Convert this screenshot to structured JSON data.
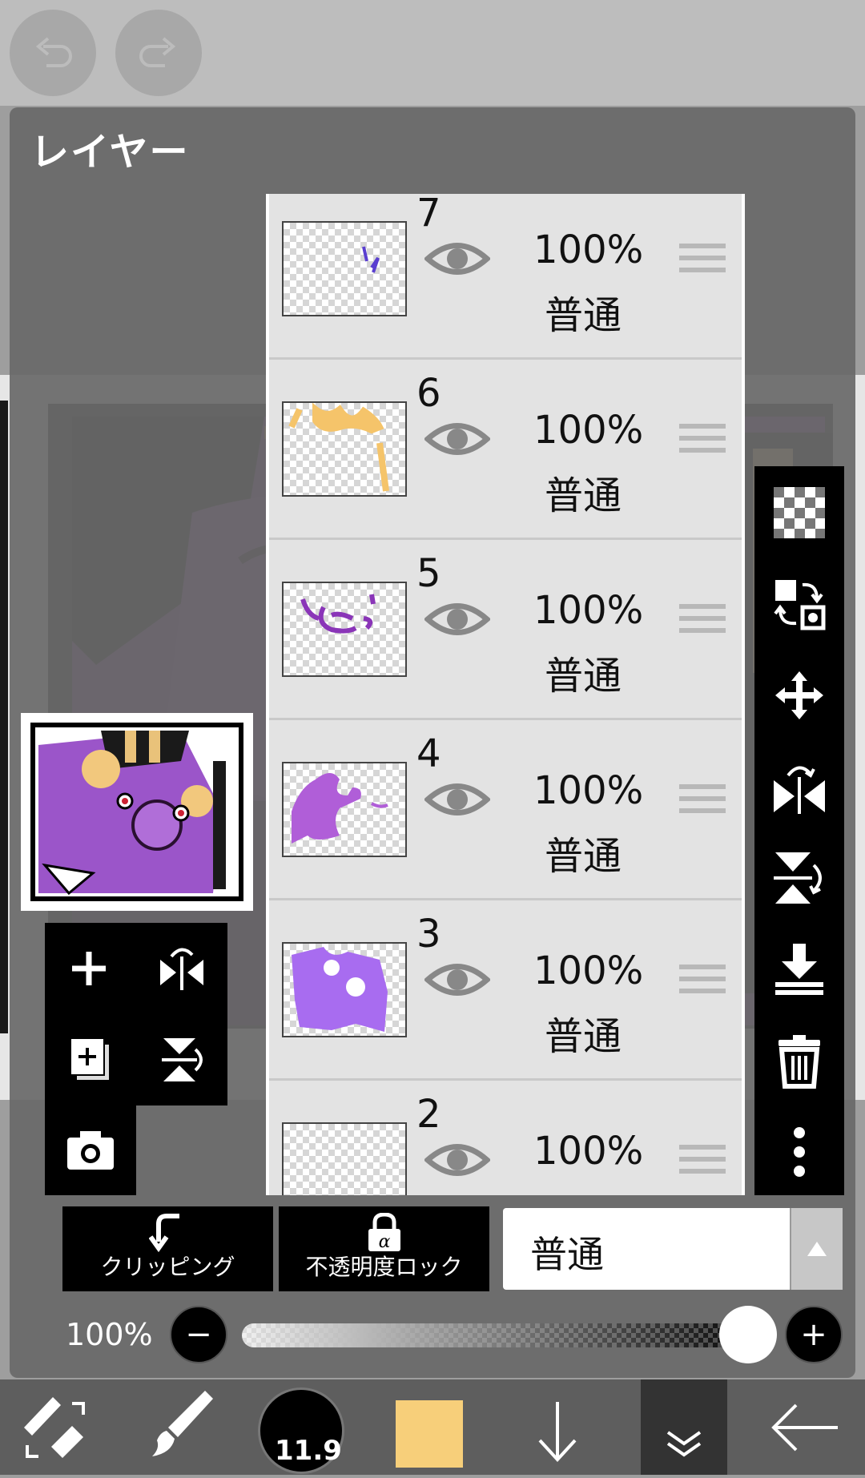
{
  "panel": {
    "title": "レイヤー"
  },
  "layers": [
    {
      "number": "7",
      "opacity": "100%",
      "blend": "普通"
    },
    {
      "number": "6",
      "opacity": "100%",
      "blend": "普通"
    },
    {
      "number": "5",
      "opacity": "100%",
      "blend": "普通"
    },
    {
      "number": "4",
      "opacity": "100%",
      "blend": "普通"
    },
    {
      "number": "3",
      "opacity": "100%",
      "blend": "普通"
    },
    {
      "number": "2",
      "opacity": "100%",
      "blend": ""
    }
  ],
  "controls": {
    "clipping_label": "クリッピング",
    "alpha_lock_label": "不透明度ロック",
    "blend_mode_value": "普通",
    "opacity_value": "100%",
    "opacity_level_percent": 100
  },
  "toolbar": {
    "brush_size": "11.9",
    "current_color": "#f7cf7a"
  },
  "icons": {
    "undo": "undo-icon",
    "redo": "redo-icon",
    "right_tools": [
      "transparent-bg-icon",
      "layer-swap-icon",
      "move-icon",
      "flip-horizontal-icon",
      "flip-vertical-icon",
      "merge-down-icon",
      "trash-icon",
      "more-icon"
    ],
    "left_tools": [
      "add-layer-icon",
      "flip-horizontal-icon",
      "duplicate-layer-icon",
      "flip-vertical-icon",
      "camera-icon"
    ],
    "bottom": [
      "transform-icon",
      "brush-icon",
      "brush-size-icon",
      "color-icon",
      "download-arrow-icon",
      "layers-collapse-icon",
      "back-arrow-icon"
    ]
  },
  "colors": {
    "accent": "#f7cf7a",
    "panel": "#6a6a6a",
    "layer_row": "#e3e3e3"
  }
}
